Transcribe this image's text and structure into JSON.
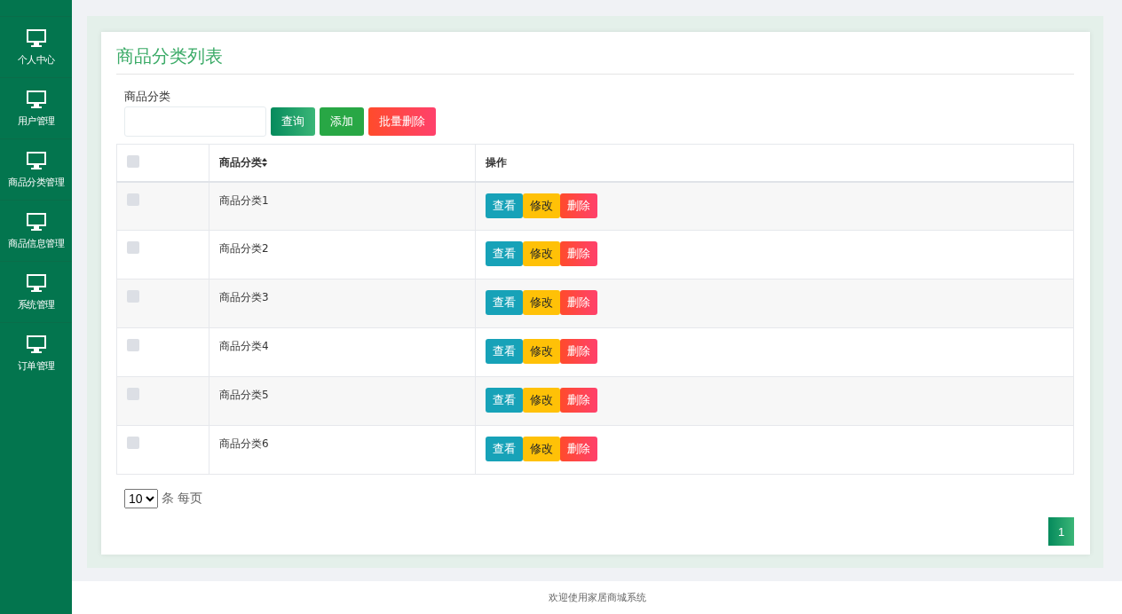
{
  "sidebar": {
    "items": [
      {
        "label": "个人中心"
      },
      {
        "label": "用户管理"
      },
      {
        "label": "商品分类管理"
      },
      {
        "label": "商品信息管理"
      },
      {
        "label": "系统管理"
      },
      {
        "label": "订单管理"
      }
    ]
  },
  "panel": {
    "title": "商品分类列表"
  },
  "search": {
    "label": "商品分类",
    "buttons": [
      {
        "label": "查询",
        "kind": "query"
      },
      {
        "label": "添加",
        "kind": "add"
      },
      {
        "label": "批量删除",
        "kind": "delete"
      }
    ]
  },
  "table": {
    "select_all": {
      "checked": false
    },
    "columns": [
      {
        "label": "商品分类",
        "sortable": true
      },
      {
        "label": "操作",
        "sortable": false
      }
    ],
    "rows": [
      {
        "checked": false,
        "name": "商品分类1",
        "actions": [
          {
            "label": "查看",
            "kind": "view"
          },
          {
            "label": "修改",
            "kind": "edit"
          },
          {
            "label": "删除",
            "kind": "delete"
          }
        ]
      },
      {
        "checked": false,
        "name": "商品分类2",
        "actions": [
          {
            "label": "查看",
            "kind": "view"
          },
          {
            "label": "修改",
            "kind": "edit"
          },
          {
            "label": "删除",
            "kind": "delete"
          }
        ]
      },
      {
        "checked": false,
        "name": "商品分类3",
        "actions": [
          {
            "label": "查看",
            "kind": "view"
          },
          {
            "label": "修改",
            "kind": "edit"
          },
          {
            "label": "删除",
            "kind": "delete"
          }
        ]
      },
      {
        "checked": false,
        "name": "商品分类4",
        "actions": [
          {
            "label": "查看",
            "kind": "view"
          },
          {
            "label": "修改",
            "kind": "edit"
          },
          {
            "label": "删除",
            "kind": "delete"
          }
        ]
      },
      {
        "checked": false,
        "name": "商品分类5",
        "actions": [
          {
            "label": "查看",
            "kind": "view"
          },
          {
            "label": "修改",
            "kind": "edit"
          },
          {
            "label": "删除",
            "kind": "delete"
          }
        ]
      },
      {
        "checked": false,
        "name": "商品分类6",
        "actions": [
          {
            "label": "查看",
            "kind": "view"
          },
          {
            "label": "修改",
            "kind": "edit"
          },
          {
            "label": "删除",
            "kind": "delete"
          }
        ]
      }
    ]
  },
  "page_size": {
    "value": "10",
    "suffix": "条 每页"
  },
  "pagination": {
    "pages": [
      {
        "label": "1",
        "selected": true
      }
    ]
  },
  "footer": {
    "text": "欢迎使用家居商城系统"
  }
}
